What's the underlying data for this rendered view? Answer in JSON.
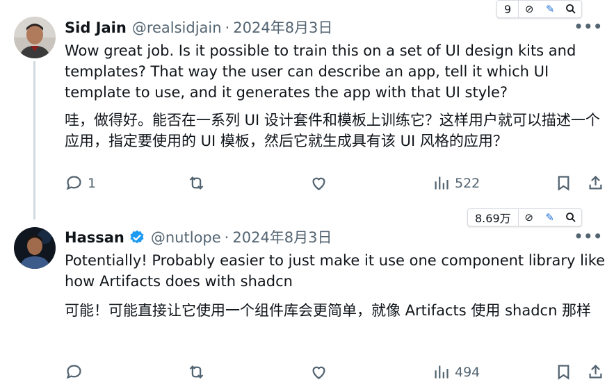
{
  "tweets": [
    {
      "name": "Sid Jain",
      "handle": "@realsidjain",
      "separator": "·",
      "date": "2024年8月3日",
      "more": "•••",
      "text_en": "Wow great job. Is it possible to train this on a set of UI design kits and templates? That way the user can describe an app, tell it which UI template to use, and it generates the app with that UI style?",
      "text_zh": "哇，做得好。能否在一系列 UI 设计套件和模板上训练它？这样用户就可以描述一个应用，指定要使用的 UI 模板，然后它就生成具有该 UI 风格的应用？",
      "replies": "1",
      "views": "522",
      "toolbar_count": "9"
    },
    {
      "name": "Hassan",
      "handle": "@nutlope",
      "separator": "·",
      "date": "2024年8月3日",
      "more": "•••",
      "text_en": "Potentially! Probably easier to just make it use one component library like how Artifacts does with shadcn",
      "text_zh": "可能！可能直接让它使用一个组件库会更简单，就像 Artifacts 使用 shadcn 那样",
      "replies": "",
      "views": "494",
      "toolbar_count": "8.69万"
    }
  ],
  "icons": {
    "verified": "verified-badge-icon",
    "reply": "reply-icon",
    "retweet": "retweet-icon",
    "like": "like-icon",
    "views": "views-icon",
    "bookmark": "bookmark-icon",
    "share": "share-icon",
    "more": "more-icon"
  },
  "colors": {
    "verified": "#1d9bf0",
    "muted": "#536471",
    "text": "#0f1419",
    "thread_line": "#cfd9de"
  }
}
